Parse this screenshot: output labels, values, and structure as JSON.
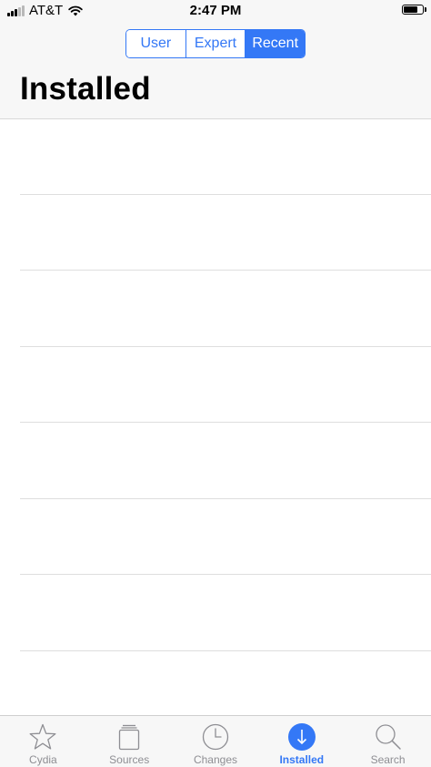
{
  "status_bar": {
    "carrier": "AT&T",
    "time": "2:47 PM"
  },
  "header": {
    "segments": [
      {
        "label": "User",
        "active": false
      },
      {
        "label": "Expert",
        "active": false
      },
      {
        "label": "Recent",
        "active": true
      }
    ],
    "title": "Installed"
  },
  "tab_bar": {
    "tabs": [
      {
        "label": "Cydia",
        "icon": "star-icon",
        "active": false
      },
      {
        "label": "Sources",
        "icon": "sources-icon",
        "active": false
      },
      {
        "label": "Changes",
        "icon": "clock-icon",
        "active": false
      },
      {
        "label": "Installed",
        "icon": "download-icon",
        "active": true
      },
      {
        "label": "Search",
        "icon": "search-icon",
        "active": false
      }
    ]
  },
  "colors": {
    "accent": "#3478f6",
    "inactive": "#8e8e93",
    "bar_background": "#f7f7f7",
    "separator": "#dedede"
  }
}
